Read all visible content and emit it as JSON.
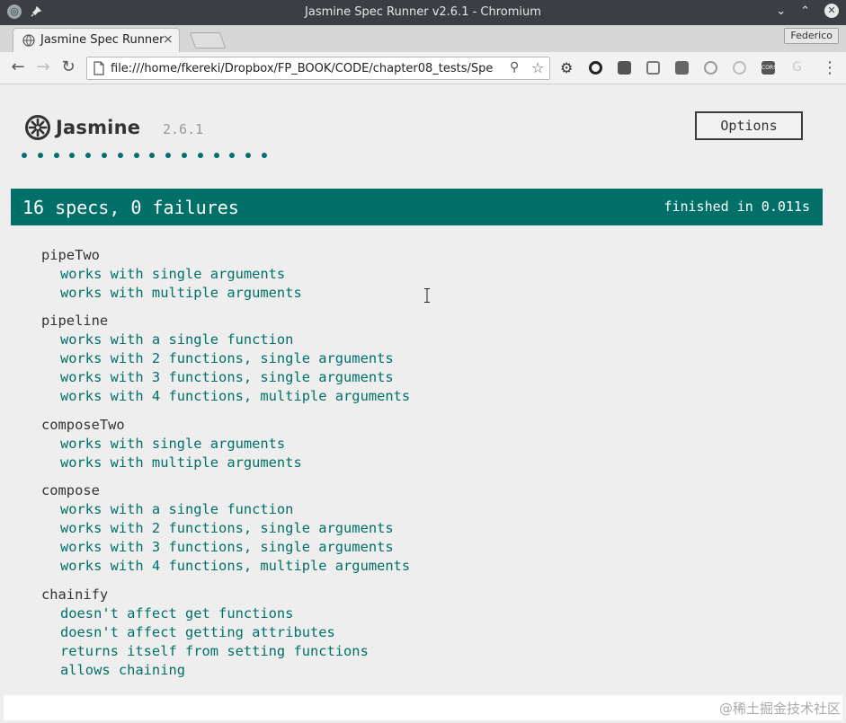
{
  "window": {
    "title": "Jasmine Spec Runner v2.6.1 - Chromium"
  },
  "tabs": [
    {
      "label": "Jasmine Spec Runner",
      "active": true
    }
  ],
  "profile": {
    "name": "Federico"
  },
  "toolbar": {
    "url": "file:///home/fkereki/Dropbox/FP_BOOK/CODE/chapter08_tests/Spe",
    "extensions": [
      "settings-gear-icon",
      "opera-icon",
      "gmail-icon",
      "dropbox-icon",
      "notes-icon",
      "react-icon",
      "shield-icon",
      "cors-icon",
      "google-icon"
    ],
    "cors_label": "CORS"
  },
  "jasmine": {
    "brand": "Jasmine",
    "version": "2.6.1",
    "options_label": "Options",
    "passed_spec_count": 16,
    "summary": "16 specs, 0 failures",
    "duration": "finished in 0.011s",
    "accent_color": "#007069"
  },
  "suites": [
    {
      "name": "pipeTwo",
      "specs": [
        "works with single arguments",
        "works with multiple arguments"
      ]
    },
    {
      "name": "pipeline",
      "specs": [
        "works with a single function",
        "works with 2 functions, single arguments",
        "works with 3 functions, single arguments",
        "works with 4 functions, multiple arguments"
      ]
    },
    {
      "name": "composeTwo",
      "specs": [
        "works with single arguments",
        "works with multiple arguments"
      ]
    },
    {
      "name": "compose",
      "specs": [
        "works with a single function",
        "works with 2 functions, single arguments",
        "works with 3 functions, single arguments",
        "works with 4 functions, multiple arguments"
      ]
    },
    {
      "name": "chainify",
      "specs": [
        "doesn't affect get functions",
        "doesn't affect getting attributes",
        "returns itself from setting functions",
        "allows chaining"
      ]
    }
  ],
  "watermark": "@稀土掘金技术社区"
}
